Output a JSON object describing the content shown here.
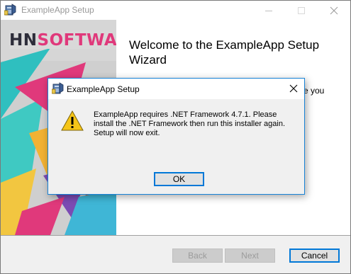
{
  "window": {
    "title": "ExampleApp Setup",
    "icon": "installer-icon"
  },
  "banner": {
    "logo_text": "HNSOFTWARE"
  },
  "wizard": {
    "heading": "Welcome to the ExampleApp Setup Wizard",
    "partial_text": "e you"
  },
  "footer": {
    "back_label": "Back",
    "next_label": "Next",
    "cancel_label": "Cancel"
  },
  "dialog": {
    "title": "ExampleApp Setup",
    "icon": "warning-icon",
    "message": "ExampleApp requires .NET Framework 4.7.1. Please install the .NET Framework then run this installer again. Setup will now exit.",
    "ok_label": "OK"
  },
  "colors": {
    "accent": "#0078d7",
    "logo_dark": "#2d2d3a",
    "logo_accent": "#e0397b",
    "warning": "#f5c518"
  }
}
